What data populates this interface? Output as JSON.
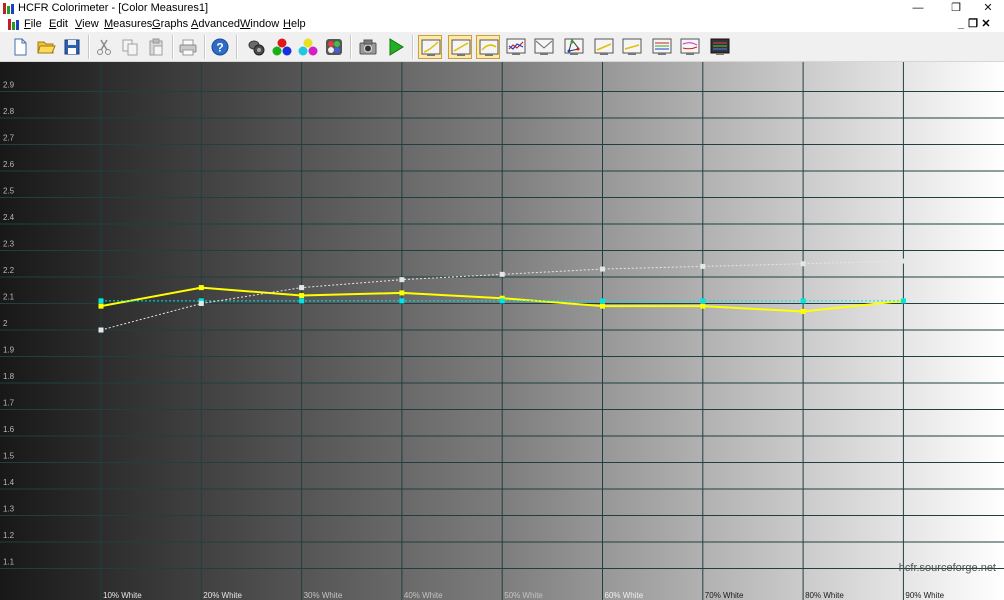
{
  "window": {
    "title": "HCFR Colorimeter - [Color Measures1]",
    "controls": {
      "minimize": "—",
      "restore": "❐",
      "close": "✕"
    }
  },
  "menu": {
    "items": [
      {
        "label": "File",
        "accel": "F",
        "rest": "ile"
      },
      {
        "label": "Edit",
        "accel": "E",
        "rest": "dit"
      },
      {
        "label": "View",
        "accel": "V",
        "rest": "iew"
      },
      {
        "label": "Measures",
        "accel": "M",
        "rest": "easures"
      },
      {
        "label": "Graphs",
        "accel": "G",
        "rest": "raphs"
      },
      {
        "label": "Advanced",
        "accel": "A",
        "rest": "dvanced"
      },
      {
        "label": "Window",
        "accel": "W",
        "rest": "indow"
      },
      {
        "label": "Help",
        "accel": "H",
        "rest": "elp"
      }
    ],
    "mdi_controls": {
      "minimize": "_",
      "restore": "❐",
      "close": "✕"
    }
  },
  "toolbar": {
    "buttons": [
      {
        "icon": "new-file-icon"
      },
      {
        "icon": "open-folder-icon"
      },
      {
        "icon": "save-icon"
      },
      {
        "icon": "cut-icon"
      },
      {
        "icon": "copy-icon"
      },
      {
        "icon": "paste-icon"
      },
      {
        "icon": "print-icon"
      },
      {
        "icon": "help-icon"
      },
      {
        "icon": "sensor-icon"
      },
      {
        "icon": "rgb-primaries-icon"
      },
      {
        "icon": "secondary-colors-icon"
      },
      {
        "icon": "color-checker-icon"
      },
      {
        "icon": "camera-icon"
      },
      {
        "icon": "play-measure-icon"
      },
      {
        "icon": "graph-luminance-icon",
        "pressed": true
      },
      {
        "icon": "graph-gamma-icon",
        "pressed": true
      },
      {
        "icon": "graph-rgb-levels-icon",
        "pressed": true
      },
      {
        "icon": "graph-color-temp-icon"
      },
      {
        "icon": "graph-delta-e-icon"
      },
      {
        "icon": "cie-diagram-icon"
      },
      {
        "icon": "graph-saturation-luminance-icon"
      },
      {
        "icon": "graph-saturation-shift-icon"
      },
      {
        "icon": "graph-near-black-icon"
      },
      {
        "icon": "graph-near-white-icon"
      },
      {
        "icon": "graph-measures-icon"
      }
    ]
  },
  "colors": {
    "gamma_line": "#ffff00",
    "reference_line": "#00e5e5",
    "average_line": "#e6e6e6",
    "grid_line": "#1e4040"
  },
  "chart_data": {
    "type": "line",
    "title": "",
    "xlabel": "",
    "ylabel": "",
    "categories": [
      "10% White",
      "20% White",
      "30% White",
      "40% White",
      "50% White",
      "60% White",
      "70% White",
      "80% White",
      "90% White"
    ],
    "x_visible_labels": [
      "10% White",
      "20% White",
      "30% White",
      "40% White",
      "50% White",
      "60% White",
      "70% White",
      "80% White",
      "90% White"
    ],
    "ylim": [
      1.0,
      3.0
    ],
    "yticks": [
      "1.1",
      "1.2",
      "1.3",
      "1.4",
      "1.5",
      "1.6",
      "1.7",
      "1.8",
      "1.9",
      "2",
      "2.1",
      "2.2",
      "2.3",
      "2.4",
      "2.5",
      "2.6",
      "2.7",
      "2.8",
      "2.9"
    ],
    "grid": true,
    "background": "grayscale-ramp",
    "series": [
      {
        "values": [
          2.09,
          2.16,
          2.13,
          2.14,
          2.12,
          2.09,
          2.09,
          2.07,
          2.11
        ],
        "style": "solid",
        "color": "#ffff00"
      },
      {
        "values": [
          2.11,
          2.11,
          2.11,
          2.11,
          2.11,
          2.11,
          2.11,
          2.11,
          2.11
        ],
        "style": "dotted",
        "color": "#00e5e5"
      },
      {
        "values": [
          2.0,
          2.1,
          2.16,
          2.19,
          2.21,
          2.23,
          2.24,
          2.25,
          2.26
        ],
        "style": "dotted",
        "color": "#e6e6e6"
      }
    ],
    "watermark": "hcfr.sourceforge.net"
  }
}
